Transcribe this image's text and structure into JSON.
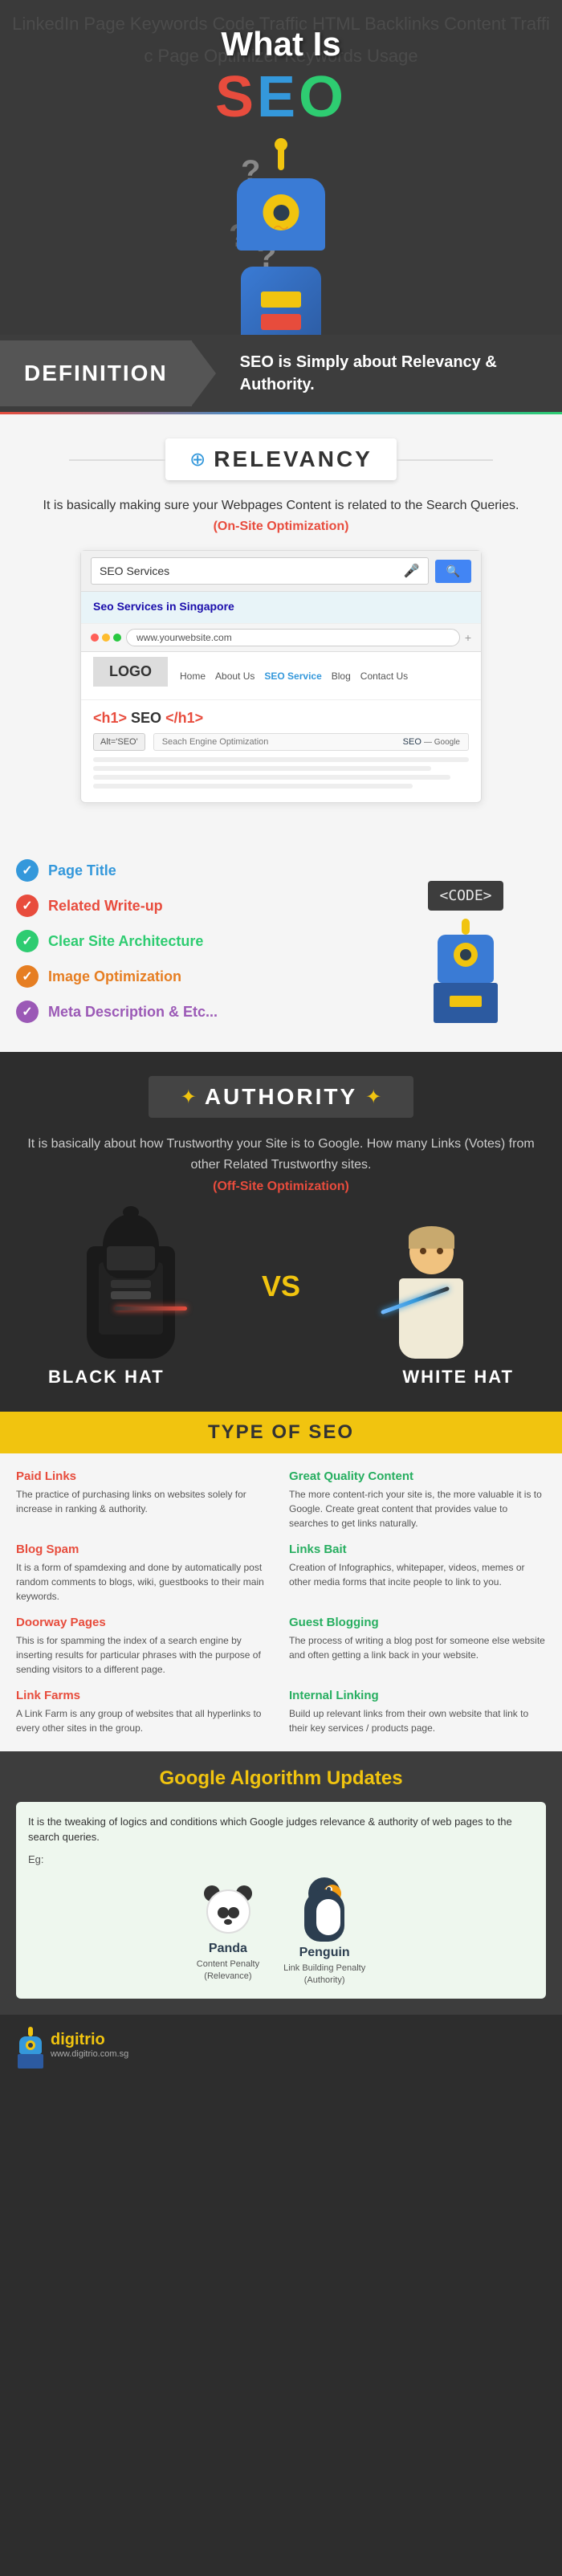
{
  "hero": {
    "what_is": "What Is",
    "seo_letters": [
      "S",
      "E",
      "O"
    ],
    "bg_words": "LinkedIn Page Keywords Code Traffic HTML Backlinks Content Traffic Page Optimizer Keywords Usage"
  },
  "definition": {
    "label": "DEFINITION",
    "text": "SEO is Simply about Relevancy & Authority."
  },
  "relevancy": {
    "title": "RELEVANCY",
    "description": "It is basically making sure your Webpages Content is related to the Search Queries.",
    "on_site": "(On-Site Optimization)",
    "search_placeholder": "SEO Services",
    "browser": {
      "url": "www.yourwebsite.com",
      "result_link": "Seo Services in Singapore",
      "nav_items": [
        "Home",
        "About Us",
        "SEO Service",
        "Blog",
        "Contact Us"
      ],
      "h1_tag": "<h1> SEO </h1>",
      "alt_tag": "Alt='SEO'",
      "search_engine_label": "Seach Engine Optimization",
      "seo_label": "SEO",
      "google_label": "Google"
    }
  },
  "checklist": {
    "items": [
      {
        "text": "Page Title",
        "color": "page"
      },
      {
        "text": "Related Write-up",
        "color": "related"
      },
      {
        "text": "Clear Site Architecture",
        "color": "clear"
      },
      {
        "text": "Image Optimization",
        "color": "image"
      },
      {
        "text": "Meta Description & Etc...",
        "color": "meta"
      }
    ],
    "code_label": "<CODE>"
  },
  "authority": {
    "title": "AUTHORITY",
    "description": "It is basically about how Trustworthy your Site is to Google. How many Links (Votes) from other Related Trustworthy sites.",
    "off_site": "(Off-Site Optimization)"
  },
  "hats": {
    "black_hat_label": "BLACK HAT",
    "vs_label": "VS",
    "white_hat_label": "WHITE HAT"
  },
  "type_of_seo": {
    "title": "TYPE OF SEO",
    "items": [
      {
        "title": "Paid Links",
        "description": "The practice of purchasing links on websites solely for increase in ranking & authority.",
        "hat": "black"
      },
      {
        "title": "Great Quality Content",
        "description": "The more content-rich your site is, the more valuable it is to Google. Create great content that provides value to searches to get links naturally.",
        "hat": "white"
      },
      {
        "title": "Blog Spam",
        "description": "It is a form of spamdexing and done by automatically post random comments to blogs, wiki, guestbooks to their main keywords.",
        "hat": "black"
      },
      {
        "title": "Links Bait",
        "description": "Creation of Infographics, whitepaper, videos, memes or other media forms that incite people to link to you.",
        "hat": "white"
      },
      {
        "title": "Doorway Pages",
        "description": "This is for spamming the index of a search engine by inserting results for particular phrases with the purpose of sending visitors to a different page.",
        "hat": "black"
      },
      {
        "title": "Guest Blogging",
        "description": "The process of writing a blog post for someone else website and often getting a link back in your website.",
        "hat": "white"
      },
      {
        "title": "Link Farms",
        "description": "A Link Farm is any group of websites that all hyperlinks to every other sites in the group.",
        "hat": "black"
      },
      {
        "title": "Internal Linking",
        "description": "Build up relevant links from their own website that link to their key services / products page.",
        "hat": "white"
      }
    ]
  },
  "google_algorithm": {
    "title": "Google Algorithm Updates",
    "description": "It is the tweaking of logics and conditions which Google judges relevance & authority of web pages to the search queries.",
    "eg_label": "Eg:",
    "updates": [
      {
        "name": "Panda",
        "subtitle": "Content Penalty",
        "penalty_type": "(Relevance)"
      },
      {
        "name": "Penguin",
        "subtitle": "Link Building Penalty",
        "penalty_type": "(Authority)"
      }
    ]
  },
  "footer": {
    "logo": "digitrio",
    "url": "www.digitrio.com.sg"
  }
}
